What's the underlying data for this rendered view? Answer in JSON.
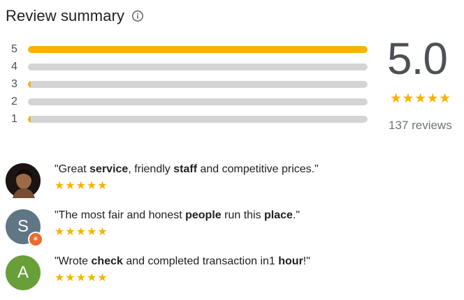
{
  "header": {
    "title": "Review summary",
    "info_icon": "info-icon"
  },
  "distribution": [
    {
      "label": "5",
      "fraction": 1.0
    },
    {
      "label": "4",
      "fraction": 0.0
    },
    {
      "label": "3",
      "fraction": 0.008
    },
    {
      "label": "2",
      "fraction": 0.0
    },
    {
      "label": "1",
      "fraction": 0.008
    }
  ],
  "summary": {
    "score": "5.0",
    "stars": "★★★★★",
    "count_text": "137 reviews",
    "rating": 5
  },
  "snippets": [
    {
      "avatar": "profile-photo",
      "parts": [
        {
          "text": "\"Great ",
          "bold": false
        },
        {
          "text": "service",
          "bold": true
        },
        {
          "text": ", friendly ",
          "bold": false
        },
        {
          "text": "staff",
          "bold": true
        },
        {
          "text": " and competitive prices.\"",
          "bold": false
        }
      ],
      "stars": "★★★★★"
    },
    {
      "avatar": "S",
      "badge": "local-guide-icon",
      "parts": [
        {
          "text": "\"The most fair and honest ",
          "bold": false
        },
        {
          "text": "people",
          "bold": true
        },
        {
          "text": " run this ",
          "bold": false
        },
        {
          "text": "place",
          "bold": true
        },
        {
          "text": ".\"",
          "bold": false
        }
      ],
      "stars": "★★★★★"
    },
    {
      "avatar": "A",
      "parts": [
        {
          "text": "\"Wrote ",
          "bold": false
        },
        {
          "text": "check",
          "bold": true
        },
        {
          "text": " and completed transaction in1 ",
          "bold": false
        },
        {
          "text": "hour",
          "bold": true
        },
        {
          "text": "!\"",
          "bold": false
        }
      ],
      "stars": "★★★★★"
    }
  ],
  "colors": {
    "accent": "#f5b400",
    "track": "#d4d4d4",
    "avatar_s": "#5f7684",
    "avatar_a": "#689f38",
    "badge": "#ea6b2b"
  }
}
